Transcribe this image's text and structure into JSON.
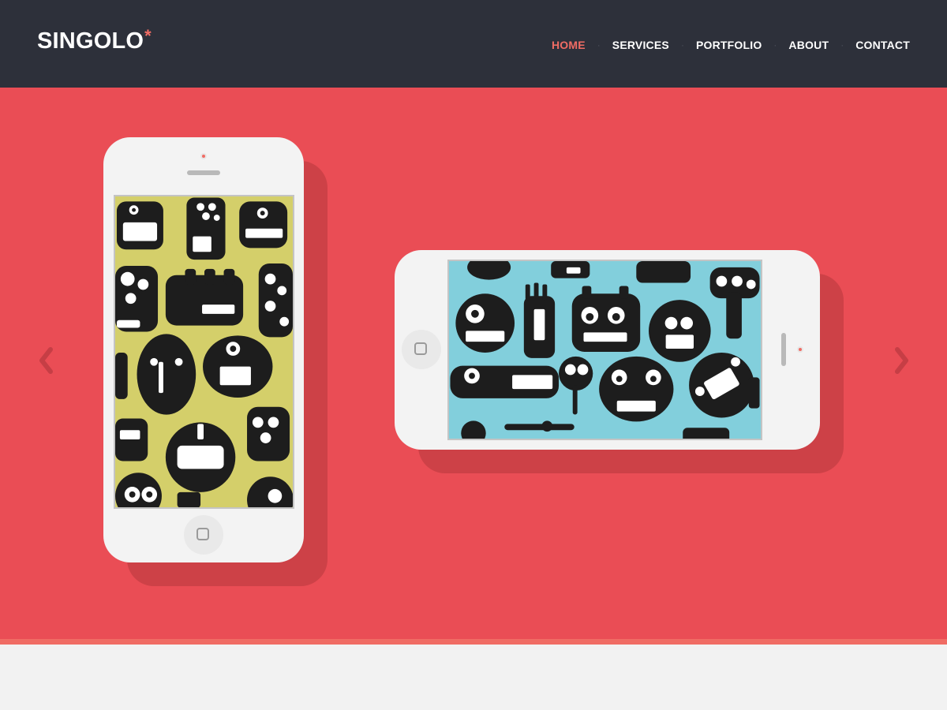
{
  "header": {
    "logo_text": "SINGOLO",
    "logo_mark": "*",
    "nav": [
      {
        "label": "HOME",
        "active": true
      },
      {
        "label": "SERVICES",
        "active": false
      },
      {
        "label": "PORTFOLIO",
        "active": false
      },
      {
        "label": "ABOUT",
        "active": false
      },
      {
        "label": "CONTACT",
        "active": false
      }
    ],
    "nav_separator": "·"
  },
  "slider": {
    "prev_icon": "chevron-left-icon",
    "next_icon": "chevron-right-icon",
    "slides": [
      {
        "device": "phone-vertical",
        "screen_color": "#d4cf6a",
        "content": "monster-pattern"
      },
      {
        "device": "phone-horizontal",
        "screen_color": "#82cfdc",
        "content": "monster-pattern"
      }
    ]
  },
  "colors": {
    "header_bg": "#2d303a",
    "accent": "#f06c64",
    "slider_bg": "#ea4d55",
    "phone_shadow": "#cd4147",
    "phone_body": "#f3f3f3",
    "page_bg": "#f2f2f2"
  }
}
